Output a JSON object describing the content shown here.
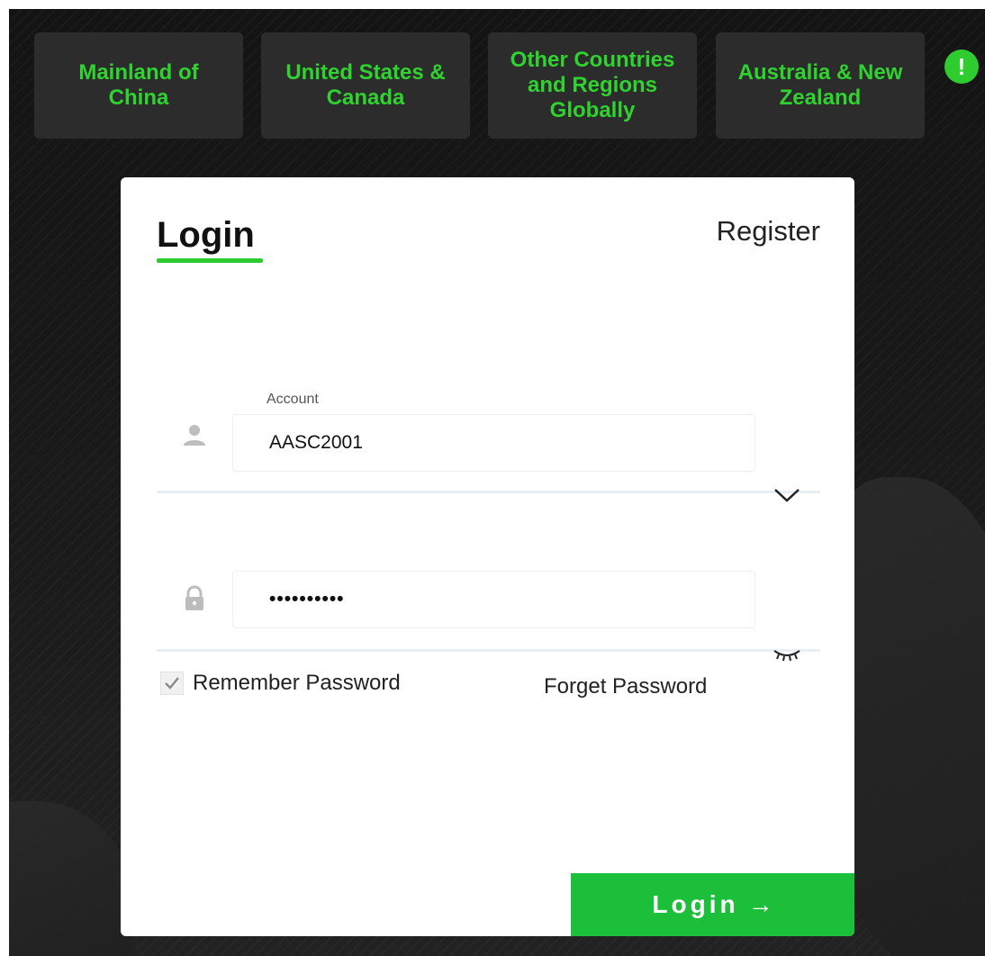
{
  "region_tabs": [
    {
      "label": "Mainland of China"
    },
    {
      "label": "United States & Canada"
    },
    {
      "label": "Other Countries and Regions Globally"
    },
    {
      "label": "Australia & New Zealand"
    }
  ],
  "alert_icon": {
    "glyph": "!",
    "icon": "exclamation-icon",
    "color": "#2ecc2e"
  },
  "auth_tabs": {
    "login_label": "Login",
    "register_label": "Register"
  },
  "account": {
    "label": "Account",
    "value": "AASC2001",
    "icon": "user-icon"
  },
  "password": {
    "value": "••••••••••",
    "icon": "lock-icon"
  },
  "remember_password": {
    "label": "Remember Password",
    "checked": true
  },
  "forget_password_label": "Forget Password",
  "login_button": {
    "label": "Login",
    "arrow": "→"
  },
  "colors": {
    "accent": "#2ecc2e",
    "button": "#1cbf3a",
    "region_text": "#2fd22f",
    "background": "#181818"
  }
}
